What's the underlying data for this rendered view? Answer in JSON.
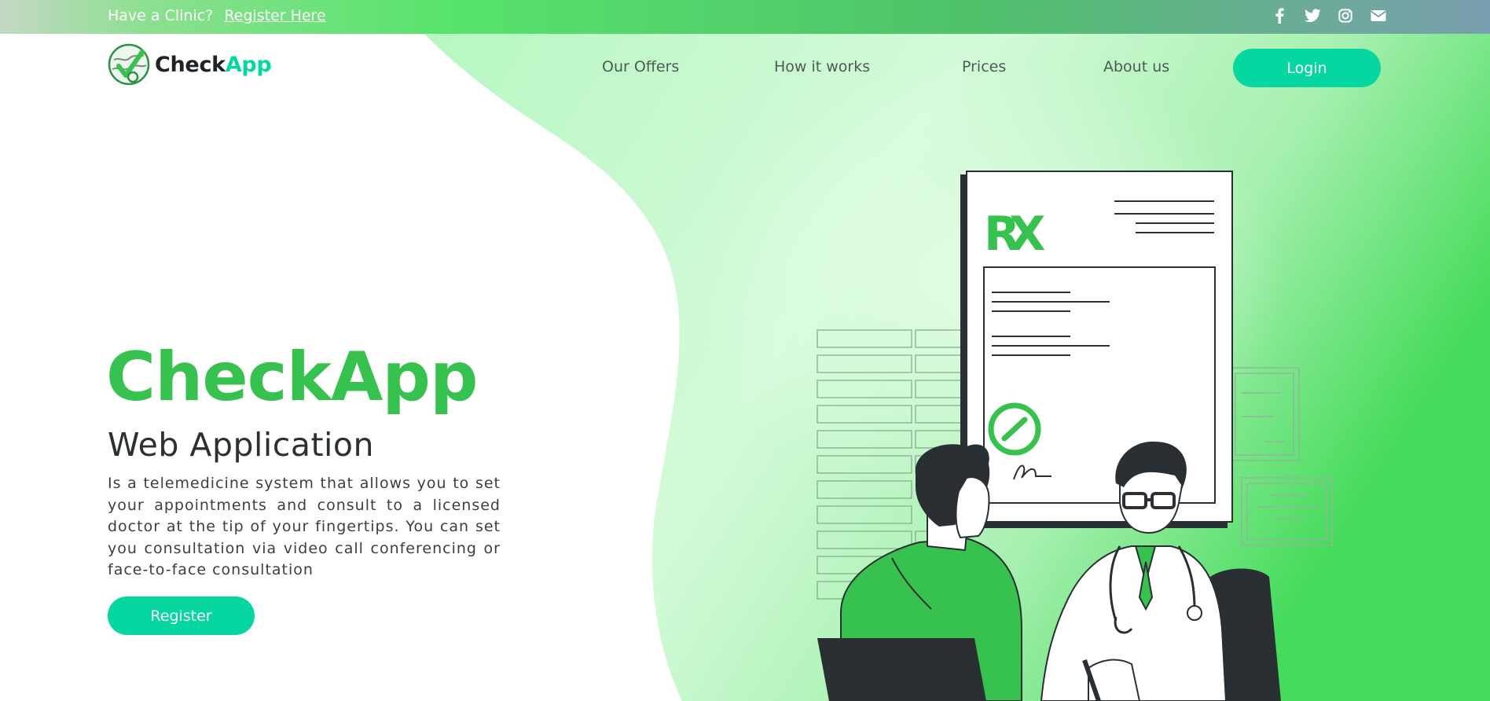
{
  "topbar": {
    "clinic_question": "Have a Clinic?",
    "register_link": "Register Here",
    "social_icons": [
      "facebook-icon",
      "twitter-icon",
      "instagram-icon",
      "envelope-icon"
    ]
  },
  "brand": {
    "name_part1": "Check",
    "name_part2": "App",
    "accent_color": "#06d6a0",
    "hero_green": "#37c14e"
  },
  "nav": {
    "items": [
      "Our Offers",
      "How it works",
      "Prices",
      "About us"
    ],
    "login_label": "Login"
  },
  "hero": {
    "title": "CheckApp",
    "subtitle": "Web Application",
    "description": "Is a telemedicine system that allows you to set your appointments and consult to a licensed doctor at the tip of your fingertips. You can set you consultation via video call conferencing or face-to-face consultation",
    "register_label": "Register"
  },
  "illustration": {
    "prescription_mark": "RX"
  }
}
